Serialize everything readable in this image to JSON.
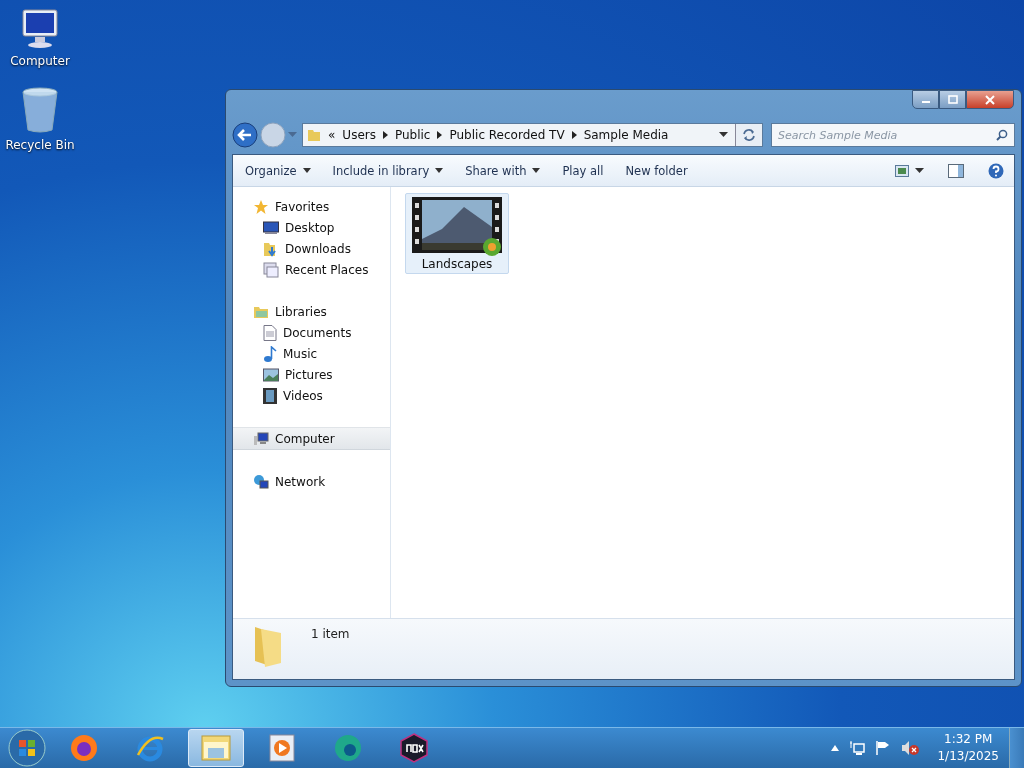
{
  "desktop": {
    "icons": [
      {
        "kind": "computer",
        "label": "Computer"
      },
      {
        "kind": "recycle",
        "label": "Recycle Bin"
      }
    ]
  },
  "window": {
    "address": {
      "overflow": "«",
      "crumbs": [
        "Users",
        "Public",
        "Public Recorded TV",
        "Sample Media"
      ]
    },
    "search": {
      "placeholder": "Search Sample Media"
    },
    "toolbar": [
      {
        "label": "Organize",
        "dropdown": true
      },
      {
        "label": "Include in library",
        "dropdown": true
      },
      {
        "label": "Share with",
        "dropdown": true
      },
      {
        "label": "Play all",
        "dropdown": false
      },
      {
        "label": "New folder",
        "dropdown": false
      }
    ],
    "nav": [
      {
        "kind": "favorites",
        "label": "Favorites",
        "selected": false,
        "children": [
          {
            "kind": "desktop",
            "label": "Desktop",
            "selected": false
          },
          {
            "kind": "downloads",
            "label": "Downloads",
            "selected": false
          },
          {
            "kind": "recent",
            "label": "Recent Places",
            "selected": false
          }
        ]
      },
      {
        "kind": "libraries",
        "label": "Libraries",
        "selected": false,
        "children": [
          {
            "kind": "documents",
            "label": "Documents",
            "selected": false
          },
          {
            "kind": "music",
            "label": "Music",
            "selected": false
          },
          {
            "kind": "pictures",
            "label": "Pictures",
            "selected": false
          },
          {
            "kind": "videos",
            "label": "Videos",
            "selected": false
          }
        ]
      },
      {
        "kind": "computer",
        "label": "Computer",
        "selected": true
      },
      {
        "kind": "network",
        "label": "Network",
        "selected": false
      }
    ],
    "files": [
      {
        "name": "Landscapes",
        "selected": true
      }
    ],
    "status": "1 item"
  },
  "taskbar": {
    "apps": [
      {
        "kind": "firefox",
        "selected": false
      },
      {
        "kind": "ie",
        "selected": false
      },
      {
        "kind": "explorer",
        "selected": true
      },
      {
        "kind": "media",
        "selected": false
      },
      {
        "kind": "edge",
        "selected": false
      },
      {
        "kind": "nox",
        "selected": false
      }
    ],
    "time": "1:32 PM",
    "date": "1/13/2025"
  }
}
